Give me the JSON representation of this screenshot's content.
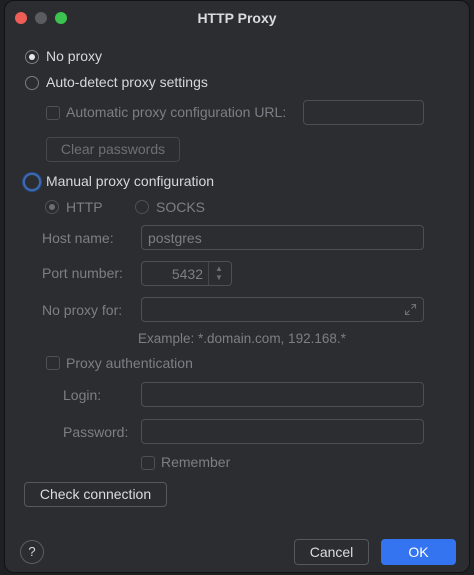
{
  "window": {
    "title": "HTTP Proxy"
  },
  "options": {
    "no_proxy": "No proxy",
    "auto_detect": "Auto-detect proxy settings",
    "auto_config_url": "Automatic proxy configuration URL:",
    "clear_passwords": "Clear passwords",
    "manual": "Manual proxy configuration"
  },
  "protocol": {
    "http": "HTTP",
    "socks": "SOCKS"
  },
  "host": {
    "label": "Host name:",
    "value": "postgres"
  },
  "port": {
    "label": "Port number:",
    "value": "5432"
  },
  "no_proxy_for": {
    "label": "No proxy for:",
    "value": "",
    "example": "Example: *.domain.com, 192.168.*"
  },
  "auth": {
    "label": "Proxy authentication",
    "login_label": "Login:",
    "password_label": "Password:",
    "remember": "Remember"
  },
  "buttons": {
    "check_connection": "Check connection",
    "help": "?",
    "cancel": "Cancel",
    "ok": "OK"
  }
}
